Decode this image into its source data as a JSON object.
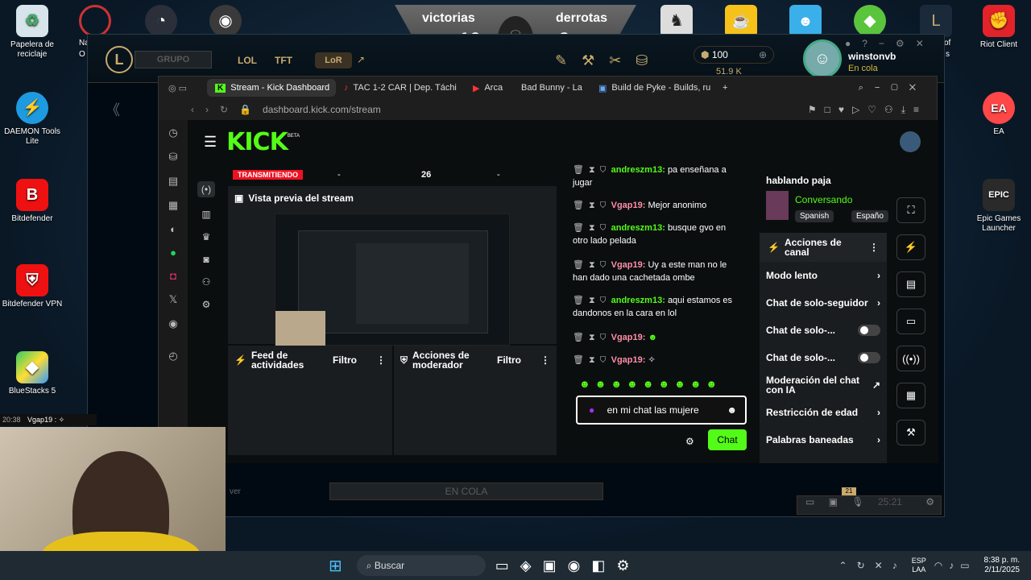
{
  "desktop": {
    "icons_left": [
      {
        "label": "Papelera de reciclaje",
        "icon": "recycle-bin-icon"
      },
      {
        "label": "DAEMON Tools Lite",
        "icon": "daemon-tools-icon"
      },
      {
        "label": "Bitdefender",
        "icon": "bitdefender-icon"
      },
      {
        "label": "Bitdefender VPN",
        "icon": "bitdefender-vpn-icon"
      },
      {
        "label": "BlueStacks 5",
        "icon": "bluestacks-icon"
      }
    ],
    "icons_right": [
      {
        "label": "Riot Client",
        "icon": "riot-client-icon"
      },
      {
        "label": "EA",
        "icon": "ea-icon"
      },
      {
        "label": "Epic Games Launcher",
        "icon": "epic-games-icon"
      }
    ],
    "partial_labels": [
      "Na",
      "O",
      "of",
      "s"
    ]
  },
  "lol_client": {
    "victorias_label": "victorias",
    "derrotas_label": "derrotas",
    "victorias": "10",
    "derrotas": "9",
    "grupo": "GRUPO",
    "tabs": [
      "LOL",
      "TFT",
      "LoR"
    ],
    "currency": "100",
    "currency2": "51.9 K",
    "username": "winstonvb",
    "status": "En cola",
    "en_cola": "EN COLA",
    "ver": "ver",
    "timer": "25:21",
    "badge": "21"
  },
  "browser": {
    "tabs": [
      {
        "label": "Stream - Kick Dashboard",
        "active": true
      },
      {
        "label": "TAC 1-2 CAR | Dep. Táchi",
        "active": false
      },
      {
        "label": "Arca",
        "active": false
      },
      {
        "label": "Bad Bunny - La",
        "active": false
      },
      {
        "label": "Build de Pyke - Builds, ru",
        "active": false
      }
    ],
    "new_tab": "+",
    "url": "dashboard.kick.com/stream"
  },
  "kick": {
    "logo": "KICK",
    "beta": "BETA",
    "live_badge": "TRANSMITIENDO",
    "stats": [
      "-",
      "26",
      "-"
    ],
    "preview_title": "Vista previa del stream",
    "feed_title": "Feed de actividades",
    "feed_filter": "Filtro",
    "mod_title": "Acciones de moderador",
    "mod_filter": "Filtro",
    "chat": [
      {
        "user": "andreszm13:",
        "text": "pa enseñana a jugar",
        "color": "green"
      },
      {
        "user": "Vgap19:",
        "text": "Mejor anonimo",
        "color": "pink"
      },
      {
        "user": "andreszm13:",
        "text": "busque gvo en otro lado pelada",
        "color": "green"
      },
      {
        "user": "Vgap19:",
        "text": "Uy a este man no le han dado una cachetada ombe",
        "color": "pink"
      },
      {
        "user": "andreszm13:",
        "text": "aqui estamos es dandonos en la cara en lol",
        "color": "green"
      },
      {
        "user": "Vgap19:",
        "text": "",
        "color": "pink"
      },
      {
        "user": "Vgap19:",
        "text": "",
        "color": "pink"
      }
    ],
    "chat_input": "en mi chat las mujere",
    "chat_button": "Chat",
    "stream_title": "hablando paja",
    "category": "Conversando",
    "tags": [
      "Spanish",
      "Españo"
    ],
    "channel_actions_title": "Acciones de canal",
    "channel_actions": [
      {
        "label": "Modo lento",
        "control": "arrow"
      },
      {
        "label": "Chat de solo-seguidor",
        "control": "arrow"
      },
      {
        "label": "Chat de solo-...",
        "control": "toggle"
      },
      {
        "label": "Chat de solo-...",
        "control": "toggle"
      },
      {
        "label": "Moderación del chat con IA",
        "control": "external"
      },
      {
        "label": "Restricción de edad",
        "control": "arrow"
      },
      {
        "label": "Palabras baneadas",
        "control": "arrow"
      }
    ]
  },
  "overlay_chat": {
    "user": "Vgap19 :",
    "time": "20:38"
  },
  "taskbar": {
    "search": "Buscar",
    "lang": "ESP",
    "lang2": "LAA",
    "time": "8:38 p. m.",
    "date": "2/11/2025"
  }
}
